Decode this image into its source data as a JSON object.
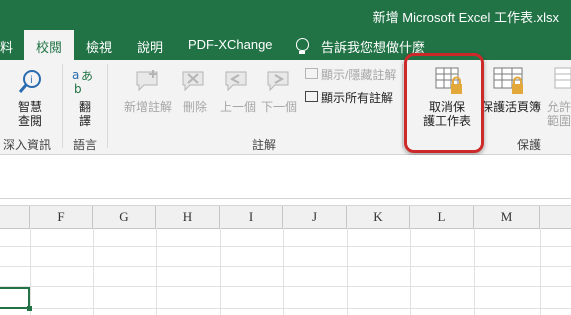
{
  "window": {
    "title": "新增 Microsoft Excel 工作表.xlsx"
  },
  "tabs": [
    {
      "label": "料"
    },
    {
      "label": "校閱",
      "active": true
    },
    {
      "label": "檢視"
    },
    {
      "label": "說明"
    },
    {
      "label": "PDF-XChange"
    },
    {
      "label": "告訴我您想做什麼"
    }
  ],
  "ribbon": {
    "insights": {
      "button": "智慧\n查閱",
      "group": "深入資訊"
    },
    "language": {
      "button": "翻\n譯",
      "group": "語言"
    },
    "comments": {
      "new": "新增註解",
      "delete": "刪除",
      "prev": "上一個",
      "next": "下一個",
      "show_hide": "顯示/隱藏註解",
      "show_all": "顯示所有註解",
      "group": "註解"
    },
    "protect": {
      "unprotect_sheet": "取消保\n護工作表",
      "protect_workbook": "保護活頁簿",
      "allow_edit": "允許\n範圍",
      "group": "保護"
    }
  },
  "columns": [
    "F",
    "G",
    "H",
    "I",
    "J",
    "K",
    "L",
    "M"
  ],
  "colors": {
    "accent": "#217346",
    "highlight": "#cc2a2a"
  }
}
